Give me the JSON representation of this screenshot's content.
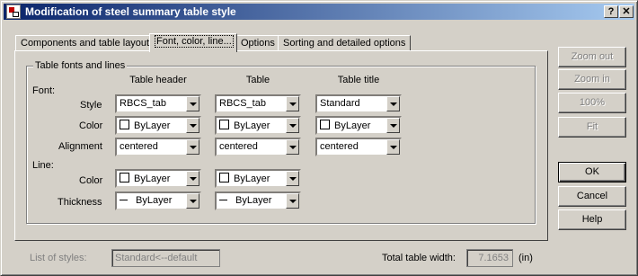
{
  "window": {
    "title": "Modification of steel summary table style",
    "help_glyph": "?",
    "close_glyph": "✕"
  },
  "tabs": [
    {
      "label": "Components and table layout"
    },
    {
      "label": "Font, color, line..."
    },
    {
      "label": "Options"
    },
    {
      "label": "Sorting and detailed options"
    }
  ],
  "group": {
    "title": "Table fonts and lines"
  },
  "columns": {
    "header": "Table header",
    "table": "Table",
    "title": "Table title"
  },
  "rows": {
    "font": "Font:",
    "style": "Style",
    "color": "Color",
    "alignment": "Alignment",
    "line": "Line:",
    "line_color": "Color",
    "thickness": "Thickness"
  },
  "values": {
    "style_header": "RBCS_tab",
    "style_table": "RBCS_tab",
    "style_title": "Standard",
    "color_header": "ByLayer",
    "color_table": "ByLayer",
    "color_title": "ByLayer",
    "align_header": "centered",
    "align_table": "centered",
    "align_title": "centered",
    "lcolor_header": "ByLayer",
    "lcolor_table": "ByLayer",
    "thick_header": "ByLayer",
    "thick_table": "ByLayer"
  },
  "buttons": {
    "zoom_out": "Zoom out",
    "zoom_in": "Zoom in",
    "zoom_100": "100%",
    "fit": "Fit",
    "ok": "OK",
    "cancel": "Cancel",
    "help": "Help"
  },
  "footer": {
    "list_label": "List of styles:",
    "list_value": "Standard<--default",
    "width_label": "Total table width:",
    "width_value": "7.1653",
    "width_unit": "(in)"
  }
}
